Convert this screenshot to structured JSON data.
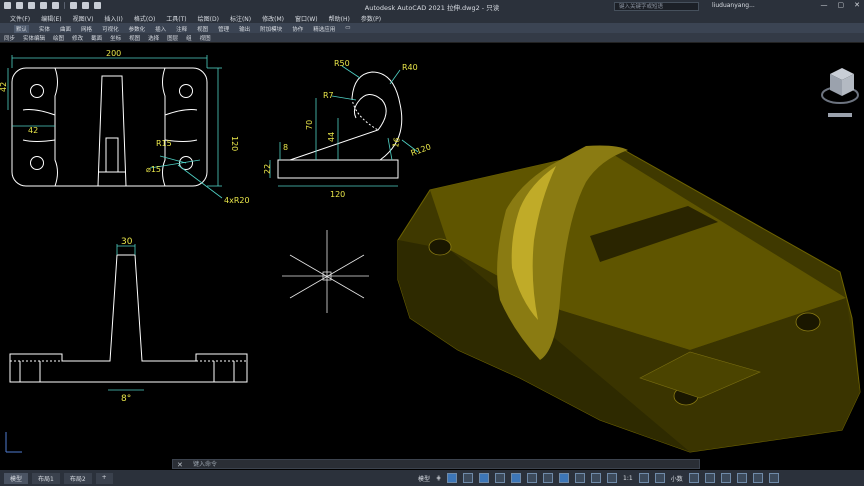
{
  "app": {
    "title": "Autodesk AutoCAD 2021    拉伸.dwg2 - 只读",
    "search_placeholder": "键入关键字或短语",
    "user": "liuduanyang...",
    "window_controls": [
      "—",
      "▢",
      "✕"
    ]
  },
  "menubar": [
    "文件(F)",
    "编辑(E)",
    "视图(V)",
    "插入(I)",
    "格式(O)",
    "工具(T)",
    "绘图(D)",
    "标注(N)",
    "修改(M)",
    "窗口(W)",
    "帮助(H)",
    "参数(P)"
  ],
  "ribbon_tabs": [
    "默认",
    "实体",
    "曲面",
    "网格",
    "可视化",
    "参数化",
    "插入",
    "注释",
    "视图",
    "管理",
    "输出",
    "附加模块",
    "协作",
    "精选应用",
    "▭"
  ],
  "toolbar": [
    "同步",
    "实体编辑",
    "绘图",
    "修改",
    "截面",
    "坐标",
    "视图",
    "选择",
    "图层",
    "组",
    "视图"
  ],
  "drawing": {
    "top_view": {
      "width": "200",
      "height": "120",
      "offset": "42",
      "side": "42",
      "fillet": "R15",
      "hole": "⌀15",
      "corners": "4xR20"
    },
    "side_view": {
      "r50": "R50",
      "r40": "R40",
      "r7": "R7",
      "h70": "70",
      "h44": "44",
      "h16": "16",
      "h8": "8",
      "h22": "22",
      "r120": "R120",
      "w120": "120"
    },
    "front_view": {
      "top": "30",
      "angle": "8°"
    }
  },
  "command": {
    "placeholder": "键入命令",
    "close": "✕",
    "prompt": "▸"
  },
  "status": {
    "tabs": [
      "模型",
      "布局1",
      "布局2",
      "+"
    ],
    "model": "模型",
    "grid": "⋕",
    "scale": "1:1",
    "units": "小数"
  },
  "colors": {
    "accent": "#3d76b7",
    "dimension": "#4fd1c5",
    "text_yellow": "#e9e64a",
    "solid": "#5a5100"
  }
}
